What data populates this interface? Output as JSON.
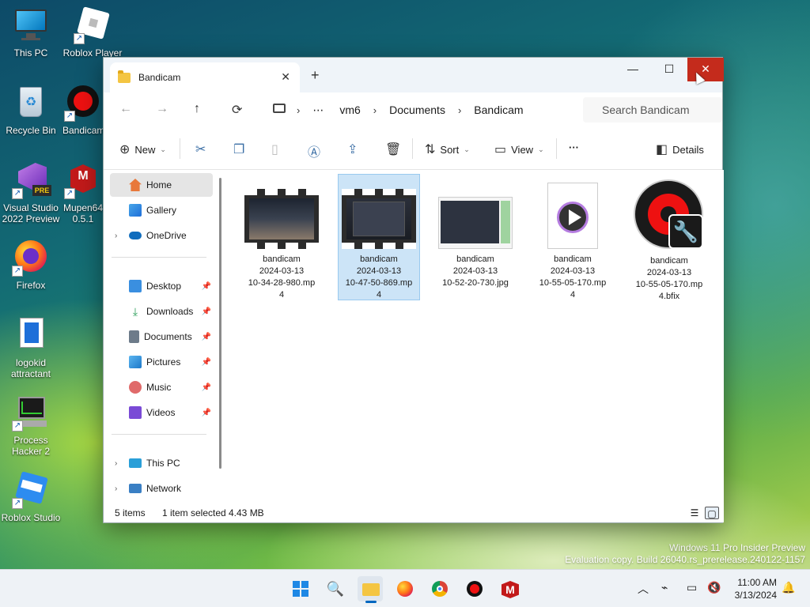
{
  "desktop": {
    "icons": [
      {
        "label": "This PC"
      },
      {
        "label": "Roblox Player"
      },
      {
        "label": "Recycle Bin"
      },
      {
        "label": "Bandicam"
      },
      {
        "label": "Visual Studio 2022 Preview"
      },
      {
        "label": "Mupen64 0.5.1"
      },
      {
        "label": "Firefox"
      },
      {
        "label": "logokid attractant"
      },
      {
        "label": "Process Hacker 2"
      },
      {
        "label": "Roblox Studio"
      }
    ],
    "badge_pre": "PRE"
  },
  "window": {
    "tab_title": "Bandicam",
    "new_tab": "+",
    "close_tab": "✕",
    "minimize": "—",
    "maximize": "☐",
    "close": "✕"
  },
  "navbar": {
    "back": "←",
    "forward": "→",
    "up": "↑",
    "refresh": "⟳",
    "breadcrumb": [
      "⋯",
      "vm6",
      "Documents",
      "Bandicam"
    ],
    "search_placeholder": "Search Bandicam"
  },
  "toolbar": {
    "new_label": "New",
    "sort_label": "Sort",
    "view_label": "View",
    "more_label": "···",
    "details_label": "Details"
  },
  "sidebar": {
    "items": [
      {
        "label": "Home",
        "selected": true
      },
      {
        "label": "Gallery"
      },
      {
        "label": "OneDrive"
      },
      {
        "label": "Desktop",
        "pinned": true
      },
      {
        "label": "Downloads",
        "pinned": true
      },
      {
        "label": "Documents",
        "pinned": true
      },
      {
        "label": "Pictures",
        "pinned": true
      },
      {
        "label": "Music",
        "pinned": true
      },
      {
        "label": "Videos",
        "pinned": true
      },
      {
        "label": "This PC"
      },
      {
        "label": "Network"
      }
    ]
  },
  "files": [
    {
      "name": "bandicam 2024-03-13 10-34-28-980.mp4",
      "line1": "bandicam",
      "line2": "2024-03-13",
      "line3": "10-34-28-980.mp",
      "line4": "4"
    },
    {
      "name": "bandicam 2024-03-13 10-47-50-869.mp4",
      "line1": "bandicam",
      "line2": "2024-03-13",
      "line3": "10-47-50-869.mp",
      "line4": "4",
      "selected": true
    },
    {
      "name": "bandicam 2024-03-13 10-52-20-730.jpg",
      "line1": "bandicam",
      "line2": "2024-03-13",
      "line3": "10-52-20-730.jpg",
      "line4": ""
    },
    {
      "name": "bandicam 2024-03-13 10-55-05-170.mp4",
      "line1": "bandicam",
      "line2": "2024-03-13",
      "line3": "10-55-05-170.mp",
      "line4": "4"
    },
    {
      "name": "bandicam 2024-03-13 10-55-05-170.mp4.bfix",
      "line1": "bandicam",
      "line2": "2024-03-13",
      "line3": "10-55-05-170.mp",
      "line4": "4.bfix"
    }
  ],
  "status": {
    "count": "5 items",
    "selection": "1 item selected",
    "size": "4.43 MB"
  },
  "watermark": {
    "line1": "Windows 11 Pro Insider Preview",
    "line2": "Evaluation copy. Build 26040.rs_prerelease.240122-1157"
  },
  "taskbar": {
    "time": "11:00 AM",
    "date": "3/13/2024"
  },
  "colors": {
    "accent": "#0067c0",
    "close_red": "#c42b1c",
    "selection_bg": "#cce4f7"
  }
}
